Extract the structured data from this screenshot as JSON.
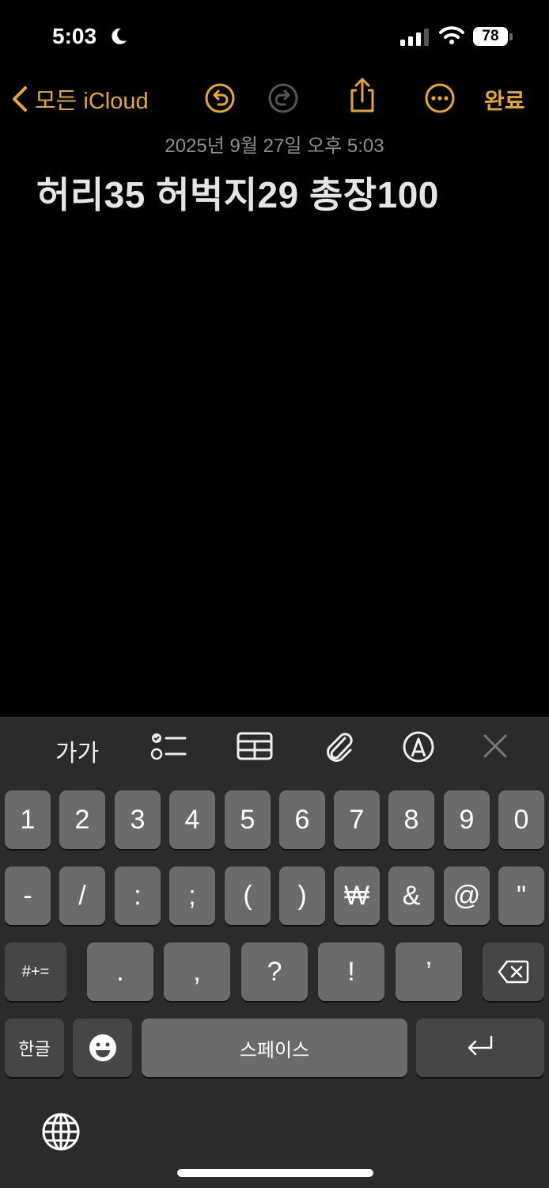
{
  "status": {
    "time": "5:03",
    "battery": "78"
  },
  "nav": {
    "back_label": "모든 iCloud",
    "done_label": "완료"
  },
  "note": {
    "date": "2025년 9월 27일 오후 5:03",
    "title": "허리35 허벅지29 총장100"
  },
  "toolbar": {
    "format_label": "가가"
  },
  "keyboard": {
    "row1": [
      "1",
      "2",
      "3",
      "4",
      "5",
      "6",
      "7",
      "8",
      "9",
      "0"
    ],
    "row2": [
      "-",
      "/",
      ":",
      ";",
      "(",
      ")",
      "₩",
      "&",
      "@",
      "\""
    ],
    "row3_mode": "#+=",
    "row3": [
      ".",
      ",",
      "?",
      "!",
      "’"
    ],
    "lang_label": "한글",
    "space_label": "스페이스"
  },
  "colors": {
    "accent": "#e6a92c",
    "key": "#6b6b6b",
    "key_dark": "#464646",
    "keyboard_bg": "#2b2b2b"
  }
}
